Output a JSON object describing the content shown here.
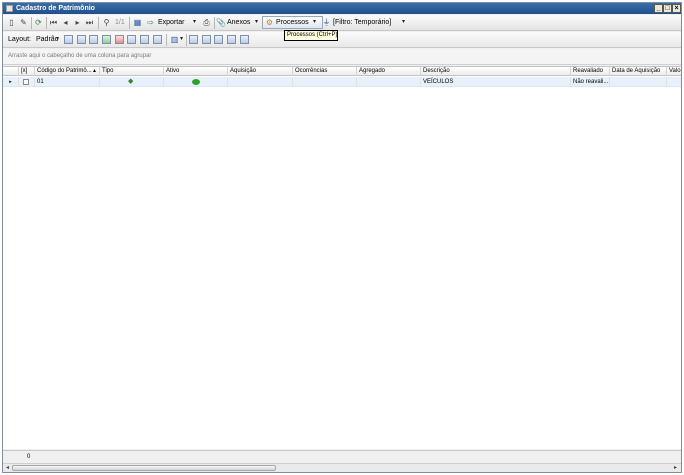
{
  "window": {
    "title": "Cadastro de Patrimônio",
    "controls": {
      "minimize": "_",
      "maximize": "□",
      "close": "×"
    }
  },
  "toolbar": {
    "page_info": "1/1",
    "exportar_label": "Exportar",
    "anexos_label": "Anexos",
    "processos_label": "Processos",
    "filtro_label": "[Filtro: Temporário]",
    "tooltip": "Processos (Ctrl+P)"
  },
  "toolbar2": {
    "layout_label": "Layout:",
    "layout_value": "Padrão"
  },
  "group_hint": "Arraste aqui o cabeçalho de uma coluna para agrupar",
  "grid": {
    "columns": [
      "[x]",
      "Código do Patrimô...",
      "Tipo",
      "Ativo",
      "Aquisição",
      "Ocorrências",
      "Agregado",
      "Descrição",
      "Reavaliado",
      "Data de Aquisição",
      "Valo"
    ],
    "rows": [
      {
        "codigo": "01",
        "descricao": "VEÍCULOS",
        "reavaliado": "Não reavali..."
      }
    ]
  },
  "footer": {
    "count": "0"
  },
  "colors": {
    "title_bar": "#1f4f8c",
    "selected_row": "#e8f1fb",
    "active_green": "#2aa52a"
  }
}
